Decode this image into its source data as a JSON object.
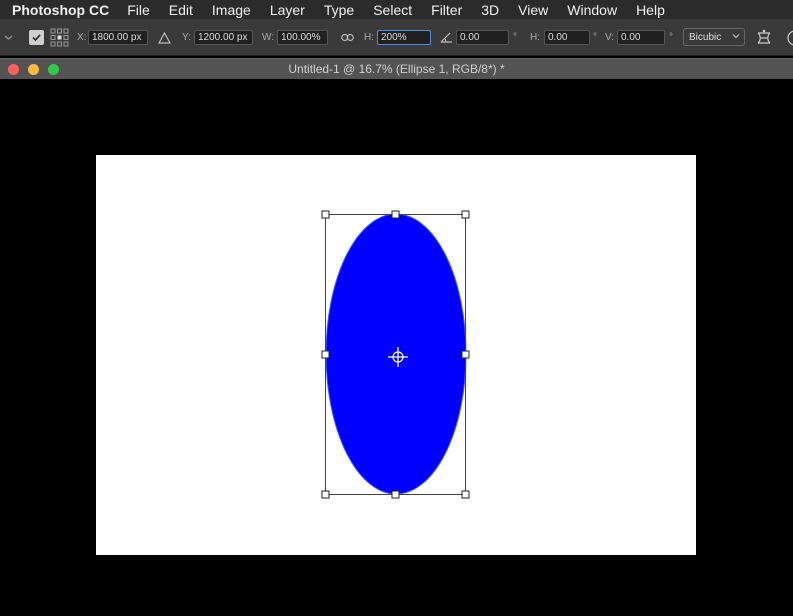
{
  "menu": {
    "app_name": "Photoshop CC",
    "items": [
      "File",
      "Edit",
      "Image",
      "Layer",
      "Type",
      "Select",
      "Filter",
      "3D",
      "View",
      "Window",
      "Help"
    ]
  },
  "options": {
    "x_label": "X:",
    "x_value": "1800.00 px",
    "y_label": "Y:",
    "y_value": "1200.00 px",
    "w_label": "W:",
    "w_value": "100.00%",
    "h_label": "H:",
    "h_value": "200%",
    "angle_value": "0.00",
    "degree_symbol": "°",
    "skew_h_label": "H:",
    "skew_h_value": "0.00",
    "skew_v_label": "V:",
    "skew_v_value": "0.00",
    "interpolation": "Bicubic"
  },
  "document": {
    "title": "Untitled-1 @ 16.7% (Ellipse 1, RGB/8*) *"
  },
  "colors": {
    "ellipse_fill": "#0000ff",
    "canvas": "#ffffff",
    "pasteboard": "#000000"
  }
}
